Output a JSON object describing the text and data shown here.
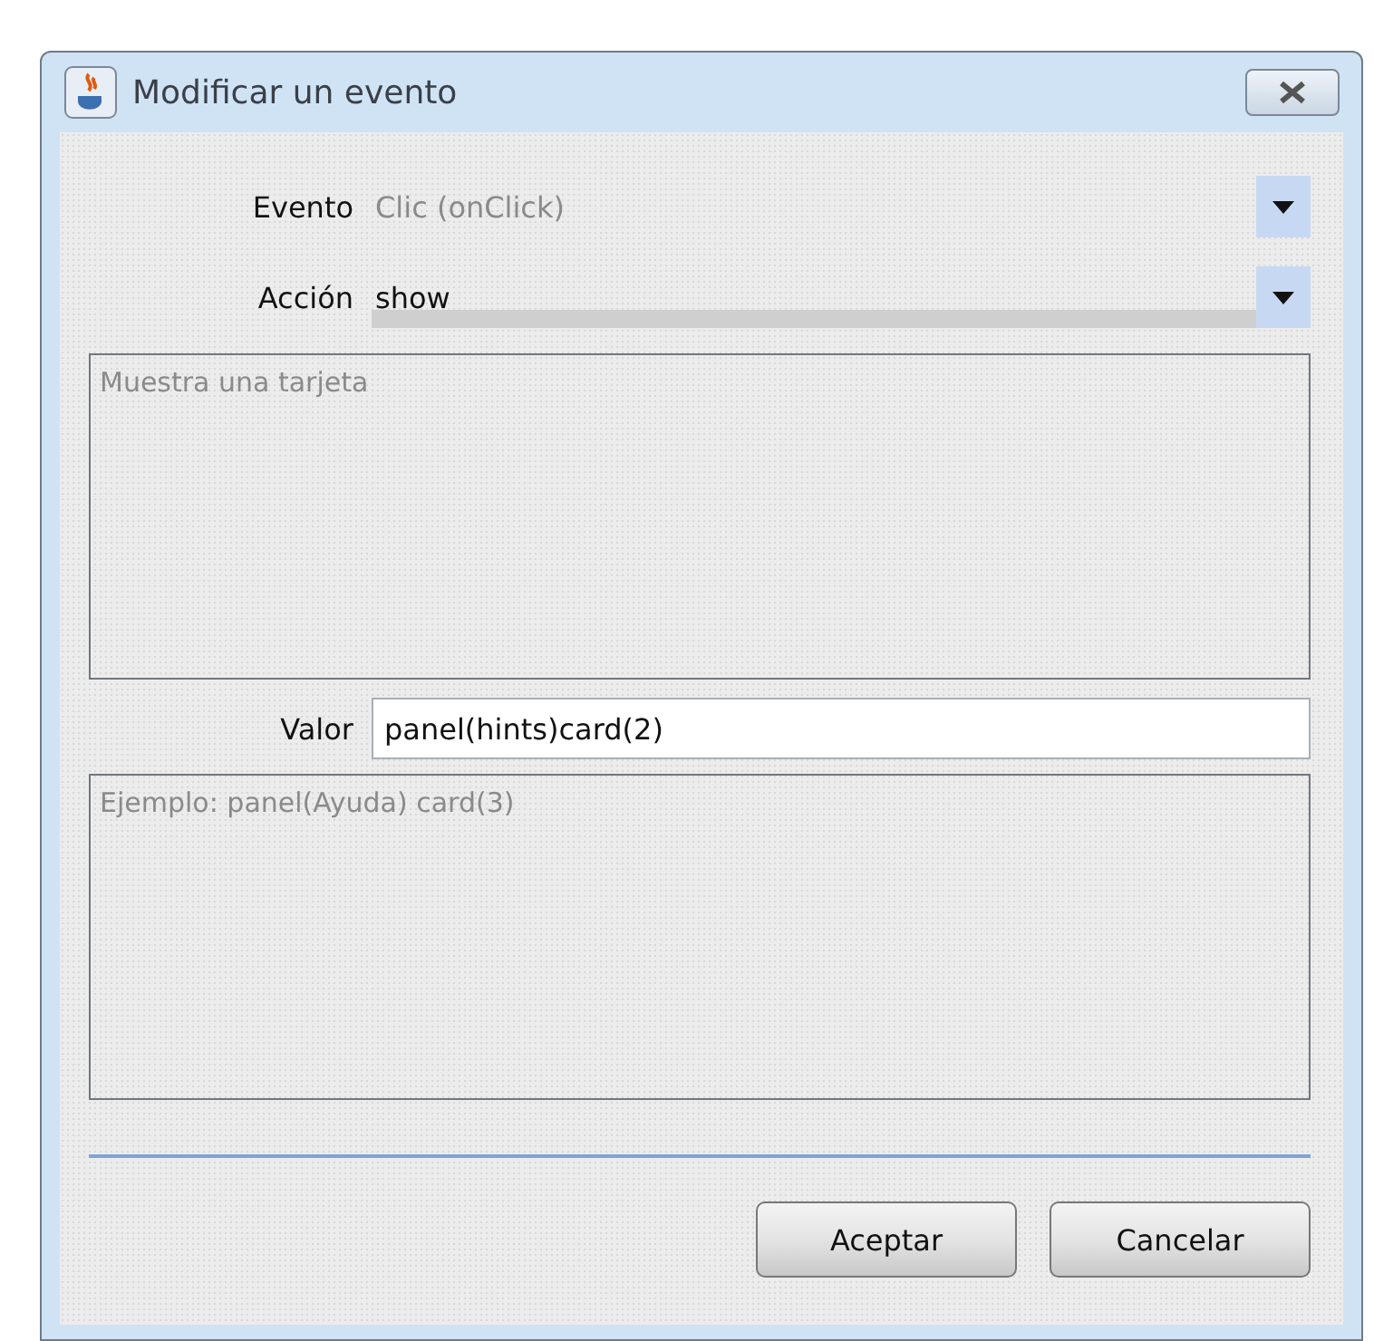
{
  "window": {
    "title": "Modificar un evento"
  },
  "fields": [
    {
      "label": "Evento",
      "value": "Clic (onClick)",
      "disabled": true,
      "focused": false
    },
    {
      "label": "Acción",
      "value": "show",
      "disabled": false,
      "focused": true
    }
  ],
  "description": "Muestra una tarjeta",
  "value_field": {
    "label": "Valor",
    "value": "panel(hints)card(2)"
  },
  "example": "Ejemplo: panel(Ayuda) card(3)",
  "buttons": [
    "Aceptar",
    "Cancelar"
  ]
}
